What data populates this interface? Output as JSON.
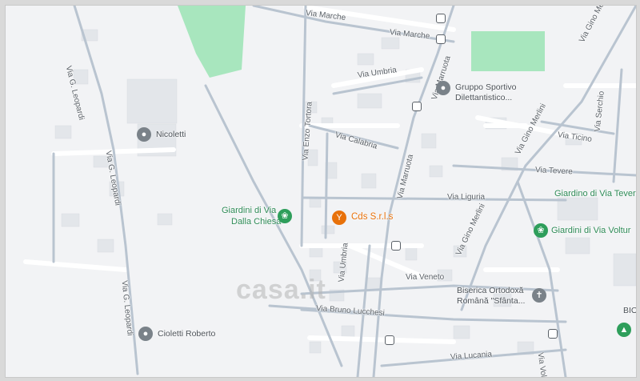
{
  "streets": {
    "via_marche_1": "Via Marche",
    "via_marche_2": "Via Marche",
    "via_umbria_1": "Via Umbria",
    "via_umbria_2": "Via Umbria",
    "via_marruota_1": "Via Marruota",
    "via_marruota_2": "Via Marruota",
    "via_leopardi_1": "Via G. Leopardi",
    "via_leopardi_2": "Via G. Leopardi",
    "via_leopardi_3": "Via G. Leopardi",
    "via_calabria": "Via Calabria",
    "via_enzo_tortora": "Via Enzo Tortora",
    "via_liguria": "Via Liguria",
    "via_veneto": "Via Veneto",
    "via_bruno_lucchesi": "Via Bruno Lucchesi",
    "via_lucania": "Via Lucania",
    "via_volturno_1": "Via Volturno",
    "via_gino_merlini_1": "Via Gino Merlini",
    "via_gino_merlini_2": "Via Gino Merlini",
    "via_gino_merlini_3": "Via Gino Merlini",
    "via_ticino": "Via Ticino",
    "via_serchio": "Via Serchio",
    "via_tevere": "Via Tevere"
  },
  "places": {
    "nicoletti": "Nicoletti",
    "cioletti": "Cioletti Roberto",
    "giardini_chiesa_1": "Giardini di Via",
    "giardini_chiesa_2": "Dalla Chiesa",
    "cds": "Cds S.r.l.s",
    "gruppo_1": "Gruppo Sportivo",
    "gruppo_2": "Dilettantistico...",
    "giardino_tevere": "Giardino di Via Tever",
    "giardini_volturno": "Giardini di Via Voltur",
    "biserica_1": "Biserica Ortodoxă",
    "biserica_2": "Română \"Sfânta...",
    "bio": "BIO"
  },
  "watermark": "casa.it",
  "colors": {
    "background": "#f2f3f5",
    "road": "#ffffff",
    "major_road": "#b9c4d0",
    "park": "#a8e6be",
    "building": "#e3e6ea",
    "accent_orange": "#e8710a",
    "park_text": "#2e8b57"
  }
}
